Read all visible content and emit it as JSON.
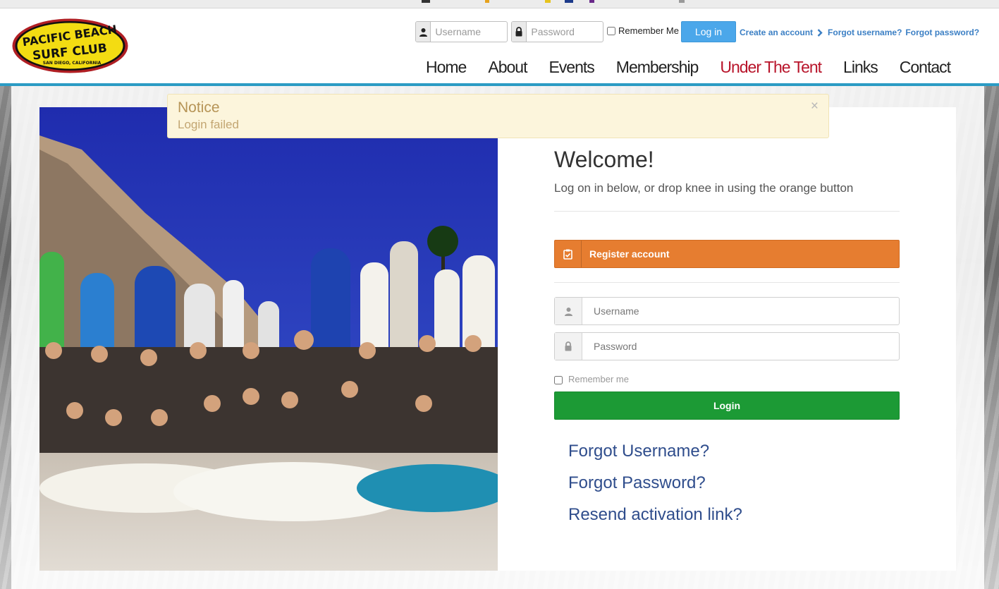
{
  "logo": {
    "line1": "PACIFIC BEACH",
    "line2": "SURF CLUB",
    "line3": "SAN DIEGO, CALIFORNIA"
  },
  "topbar": {
    "username_placeholder": "Username",
    "password_placeholder": "Password",
    "remember_label": "Remember Me",
    "login_label": "Log in",
    "create_account": "Create an account",
    "forgot_username": "Forgot username?",
    "forgot_password": "Forgot password?"
  },
  "nav": {
    "items": [
      {
        "label": "Home"
      },
      {
        "label": "About"
      },
      {
        "label": "Events"
      },
      {
        "label": "Membership"
      },
      {
        "label": "Under The Tent"
      },
      {
        "label": "Links"
      },
      {
        "label": "Contact"
      }
    ]
  },
  "notice": {
    "title": "Notice",
    "message": "Login failed",
    "close": "×"
  },
  "welcome": {
    "title": "Welcome!",
    "subtitle": "Log on in below, or drop knee in using the orange button"
  },
  "form": {
    "register_label": "Register account",
    "username_placeholder": "Username",
    "password_placeholder": "Password",
    "remember_label": "Remember me",
    "login_label": "Login",
    "forgot_username": "Forgot Username?",
    "forgot_password": "Forgot Password?",
    "resend_activation": "Resend activation link?"
  },
  "colors": {
    "accent_blue": "#2b9bc4",
    "active_nav": "#b8142a",
    "register_orange": "#e67d30",
    "login_green": "#1c9a35",
    "notice_bg": "#fcf5dc",
    "link_blue": "#2f4d8c"
  }
}
